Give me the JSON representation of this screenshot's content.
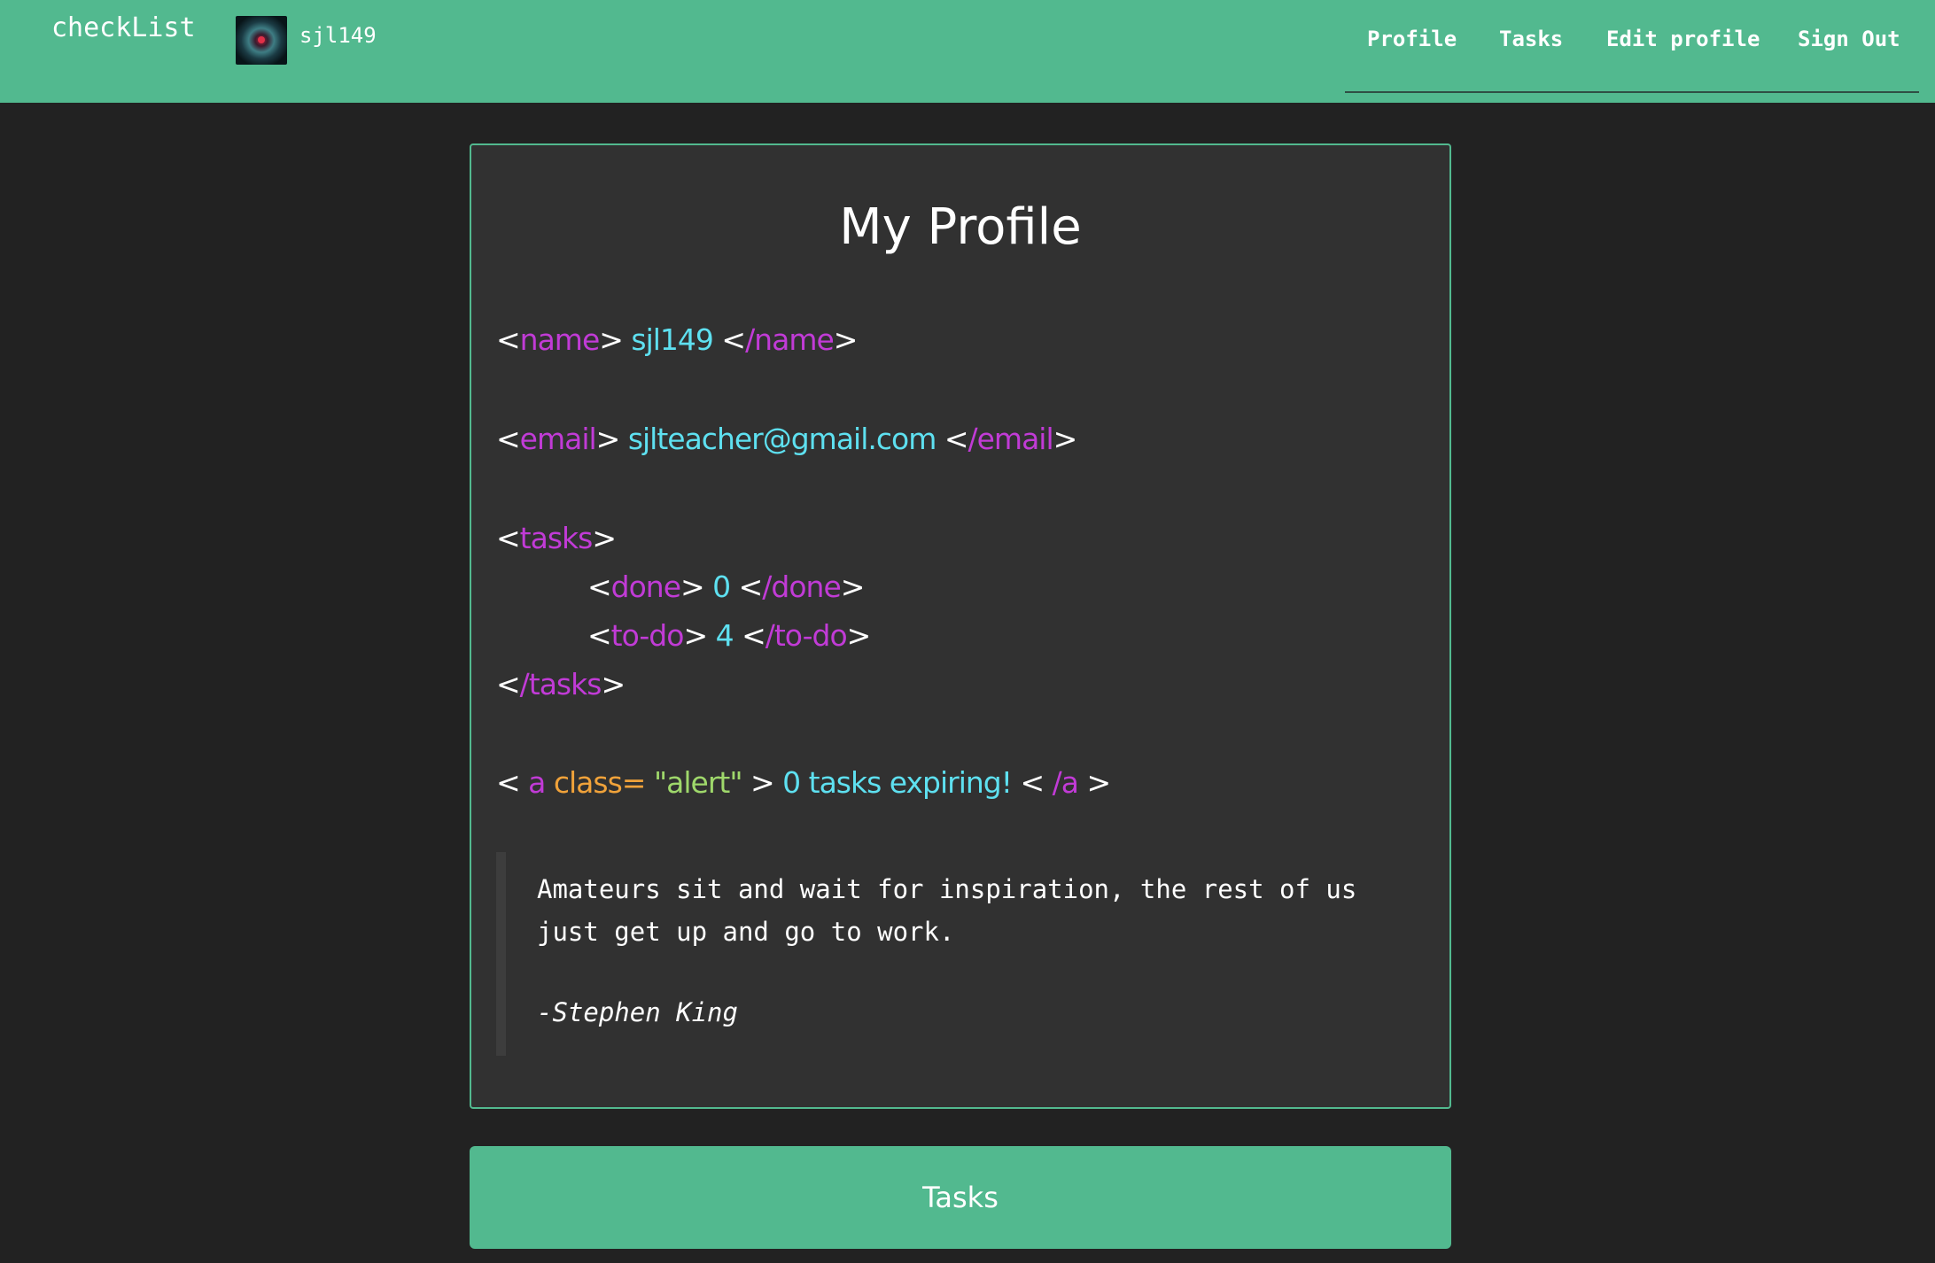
{
  "navbar": {
    "brand": "checkList",
    "username": "sjl149",
    "links": [
      "Profile",
      "Tasks",
      "Edit profile",
      "Sign Out"
    ]
  },
  "profile": {
    "title": "My Profile",
    "name_open": "name",
    "name_value": "sjl149",
    "name_close": "/name",
    "email_open": "email",
    "email_value": "sjlteacher@gmail.com",
    "email_close": "/email",
    "tasks_open": "tasks",
    "done_open": "done",
    "done_value": "0",
    "done_close": "/done",
    "todo_open": "to-do",
    "todo_value": "4",
    "todo_close": "/to-do",
    "tasks_close": "/tasks",
    "alert_tag": "a",
    "alert_attr": "class=",
    "alert_attr_value": "\"alert\"",
    "alert_text": "0 tasks expiring!",
    "alert_close": "/a"
  },
  "quote": {
    "text": "Amateurs sit and wait for inspiration, the rest of us just get up and go to work.",
    "author": "-Stephen King"
  },
  "tasks_button": "Tasks",
  "colors": {
    "accent": "#52b98f",
    "background": "#222222",
    "card": "#313131",
    "tag": "#c13bd6",
    "value": "#5ee0f0",
    "attr": "#f0a23a",
    "string": "#9fd86b"
  }
}
